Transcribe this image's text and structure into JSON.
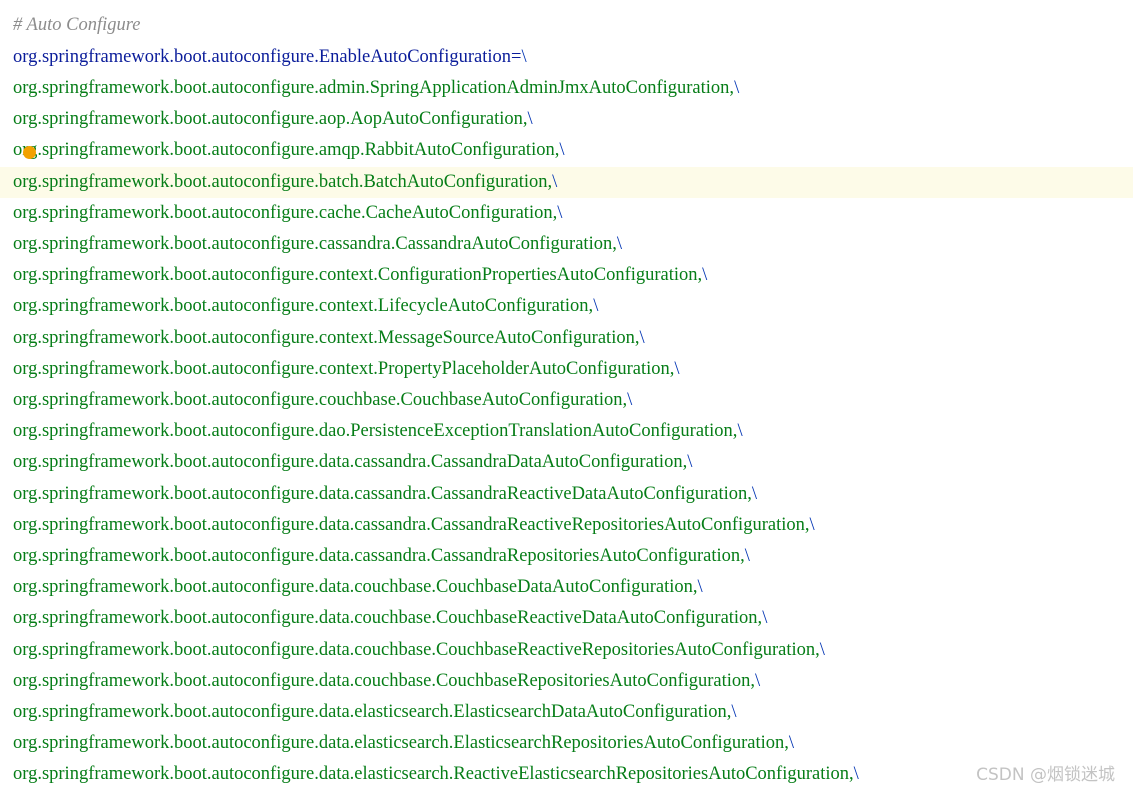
{
  "editor": {
    "comment": "# Auto Configure",
    "key": "org.springframework.boot.autoconfigure.EnableAutoConfiguration=",
    "key_cont": "\\",
    "values": [
      "org.springframework.boot.autoconfigure.admin.SpringApplicationAdminJmxAutoConfiguration,",
      "org.springframework.boot.autoconfigure.aop.AopAutoConfiguration,",
      "org.springframework.boot.autoconfigure.amqp.RabbitAutoConfiguration,",
      "org.springframework.boot.autoconfigure.batch.BatchAutoConfiguration,",
      "org.springframework.boot.autoconfigure.cache.CacheAutoConfiguration,",
      "org.springframework.boot.autoconfigure.cassandra.CassandraAutoConfiguration,",
      "org.springframework.boot.autoconfigure.context.ConfigurationPropertiesAutoConfiguration,",
      "org.springframework.boot.autoconfigure.context.LifecycleAutoConfiguration,",
      "org.springframework.boot.autoconfigure.context.MessageSourceAutoConfiguration,",
      "org.springframework.boot.autoconfigure.context.PropertyPlaceholderAutoConfiguration,",
      "org.springframework.boot.autoconfigure.couchbase.CouchbaseAutoConfiguration,",
      "org.springframework.boot.autoconfigure.dao.PersistenceExceptionTranslationAutoConfiguration,",
      "org.springframework.boot.autoconfigure.data.cassandra.CassandraDataAutoConfiguration,",
      "org.springframework.boot.autoconfigure.data.cassandra.CassandraReactiveDataAutoConfiguration,",
      "org.springframework.boot.autoconfigure.data.cassandra.CassandraReactiveRepositoriesAutoConfiguration,",
      "org.springframework.boot.autoconfigure.data.cassandra.CassandraRepositoriesAutoConfiguration,",
      "org.springframework.boot.autoconfigure.data.couchbase.CouchbaseDataAutoConfiguration,",
      "org.springframework.boot.autoconfigure.data.couchbase.CouchbaseReactiveDataAutoConfiguration,",
      "org.springframework.boot.autoconfigure.data.couchbase.CouchbaseReactiveRepositoriesAutoConfiguration,",
      "org.springframework.boot.autoconfigure.data.couchbase.CouchbaseRepositoriesAutoConfiguration,",
      "org.springframework.boot.autoconfigure.data.elasticsearch.ElasticsearchDataAutoConfiguration,",
      "org.springframework.boot.autoconfigure.data.elasticsearch.ElasticsearchRepositoriesAutoConfiguration,",
      "org.springframework.boot.autoconfigure.data.elasticsearch.ReactiveElasticsearchRepositoriesAutoConfiguration,"
    ],
    "continuation": "\\",
    "current_line_index": 4,
    "watermark": "CSDN @烟锁迷城",
    "colors": {
      "comment": "#8c8c8c",
      "key": "#0a1c9a",
      "value": "#067d17",
      "current_line": "#fdfbe8",
      "bulb": "#f2a100"
    },
    "icons": {
      "intention_bulb": "lightbulb-icon"
    }
  }
}
